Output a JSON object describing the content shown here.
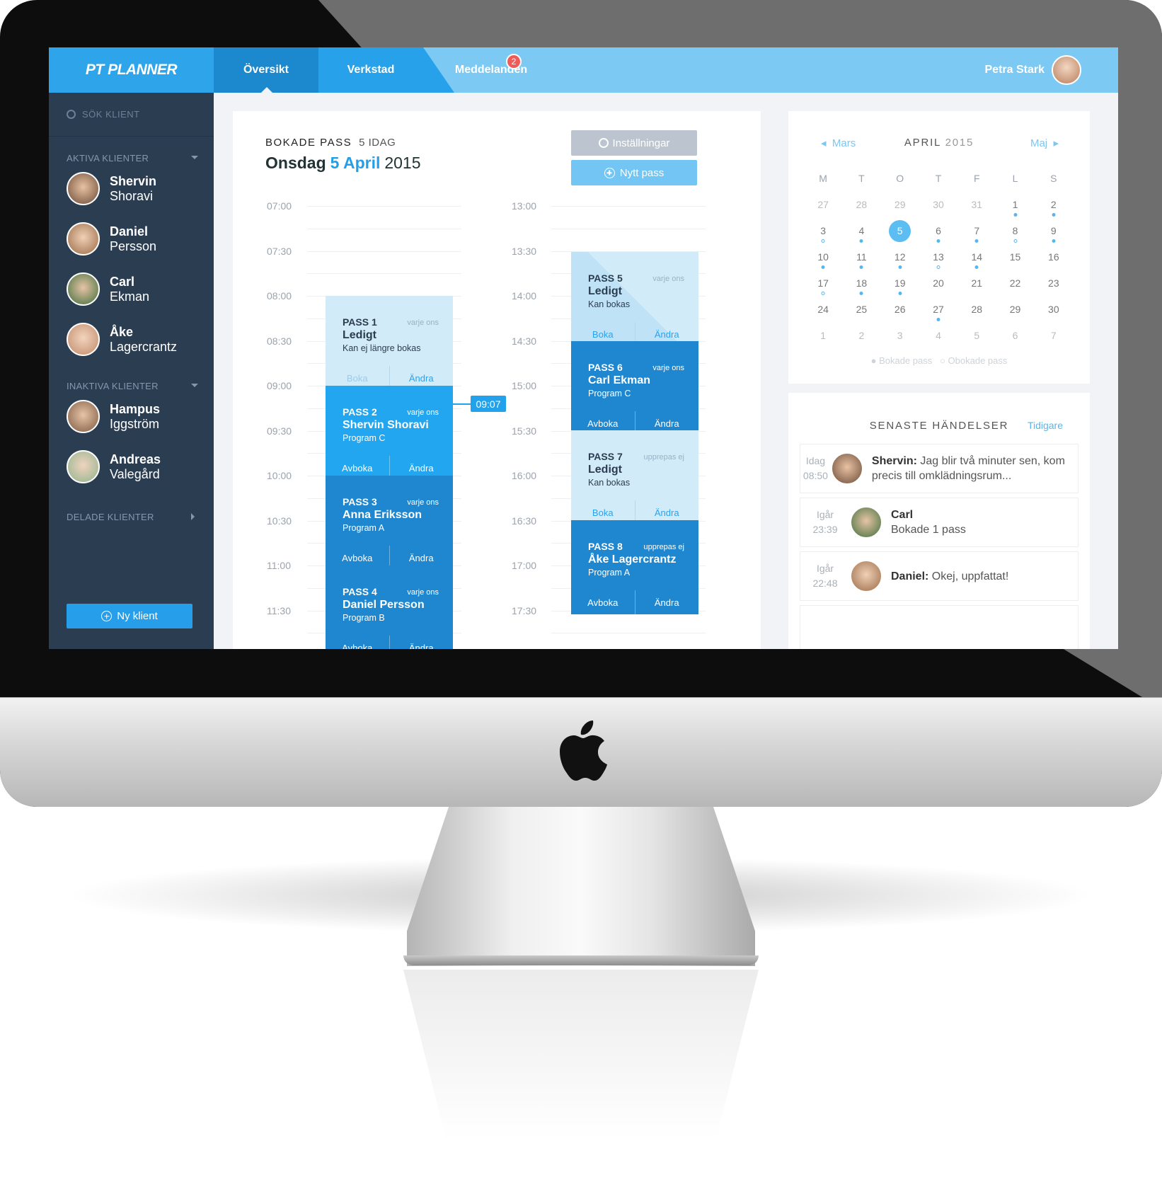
{
  "app": {
    "logo": "PT PLANNER"
  },
  "nav": {
    "tabs": [
      "Översikt",
      "Verkstad",
      "Meddelanden"
    ],
    "badge": "2",
    "user_name": "Petra Stark"
  },
  "sidebar": {
    "search_placeholder": "SÖK KLIENT",
    "active_title": "AKTIVA KLIENTER",
    "active": [
      {
        "first": "Shervin",
        "last": "Shoravi"
      },
      {
        "first": "Daniel",
        "last": "Persson"
      },
      {
        "first": "Carl",
        "last": "Ekman"
      },
      {
        "first": "Åke",
        "last": "Lagercrantz"
      }
    ],
    "inactive_title": "INAKTIVA KLIENTER",
    "inactive": [
      {
        "first": "Hampus",
        "last": "Iggström"
      },
      {
        "first": "Andreas",
        "last": "Valegård"
      }
    ],
    "shared_title": "DELADE KLIENTER",
    "new_client": "Ny klient"
  },
  "schedule": {
    "title": "BOKADE PASS",
    "count": "5 IDAG",
    "weekday": "Onsdag",
    "date": "5 April",
    "year": "2015",
    "settings": "Inställningar",
    "new_session": "Nytt pass",
    "times_left": [
      "07:00",
      "07:30",
      "08:00",
      "08:30",
      "09:00",
      "09:30",
      "10:00",
      "10:30",
      "11:00",
      "11:30"
    ],
    "times_right": [
      "13:00",
      "13:30",
      "14:00",
      "14:30",
      "15:00",
      "15:30",
      "16:00",
      "16:30",
      "17:00",
      "17:30"
    ],
    "now": "09:07",
    "sessions": [
      {
        "label": "PASS 1",
        "recur": "varje ons",
        "name": "Ledigt",
        "info": "Kan ej längre bokas",
        "a1": "Boka",
        "a2": "Ändra"
      },
      {
        "label": "PASS 2",
        "recur": "varje ons",
        "name": "Shervin Shoravi",
        "info": "Program C",
        "a1": "Avboka",
        "a2": "Ändra"
      },
      {
        "label": "PASS 3",
        "recur": "varje ons",
        "name": "Anna Eriksson",
        "info": "Program A",
        "a1": "Avboka",
        "a2": "Ändra"
      },
      {
        "label": "PASS 4",
        "recur": "varje ons",
        "name": "Daniel Persson",
        "info": "Program B",
        "a1": "Avboka",
        "a2": "Ändra"
      },
      {
        "label": "PASS 5",
        "recur": "varje ons",
        "name": "Ledigt",
        "info": "Kan bokas",
        "a1": "Boka",
        "a2": "Ändra"
      },
      {
        "label": "PASS 6",
        "recur": "varje ons",
        "name": "Carl Ekman",
        "info": "Program C",
        "a1": "Avboka",
        "a2": "Ändra"
      },
      {
        "label": "PASS 7",
        "recur": "upprepas ej",
        "name": "Ledigt",
        "info": "Kan bokas",
        "a1": "Boka",
        "a2": "Ändra"
      },
      {
        "label": "PASS 8",
        "recur": "upprepas ej",
        "name": "Åke Lagercrantz",
        "info": "Program A",
        "a1": "Avboka",
        "a2": "Ändra"
      }
    ]
  },
  "calendar": {
    "prev": "Mars",
    "next": "Maj",
    "month": "APRIL",
    "year": "2015",
    "weekdays": [
      "M",
      "T",
      "O",
      "T",
      "F",
      "L",
      "S"
    ],
    "legend_booked": "Bokade pass",
    "legend_unbooked": "Obokade pass"
  },
  "events": {
    "title": "SENASTE HÄNDELSER",
    "earlier": "Tidigare",
    "items": [
      {
        "day": "Idag",
        "time": "08:50",
        "who": "Shervin:",
        "text": "Jag blir två minuter sen, kom precis till omklädningsrum..."
      },
      {
        "day": "Igår",
        "time": "23:39",
        "who": "Carl",
        "text": "Bokade 1 pass"
      },
      {
        "day": "Igår",
        "time": "22:48",
        "who": "Daniel:",
        "text": "Okej, uppfattat!"
      }
    ]
  }
}
